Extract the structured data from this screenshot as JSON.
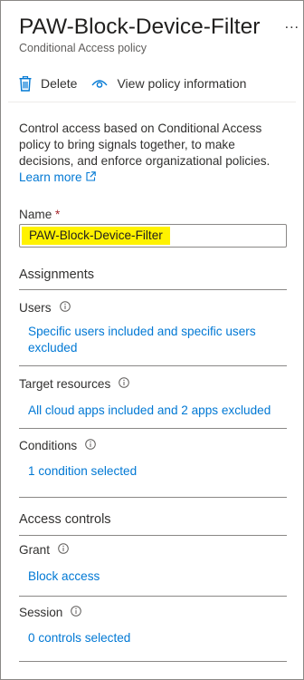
{
  "header": {
    "title": "PAW-Block-Device-Filter",
    "subtitle": "Conditional Access policy",
    "more_label": "..."
  },
  "toolbar": {
    "delete_label": "Delete",
    "view_label": "View policy information"
  },
  "intro": {
    "description": "Control access based on Conditional Access policy to bring signals together, to make decisions, and enforce organizational policies.",
    "learn_more": "Learn more"
  },
  "name_field": {
    "label": "Name",
    "required_marker": "*",
    "value": "PAW-Block-Device-Filter"
  },
  "assignments": {
    "heading": "Assignments",
    "users": {
      "label": "Users",
      "link": "Specific users included and specific users excluded"
    },
    "target_resources": {
      "label": "Target resources",
      "link": "All cloud apps included and 2 apps excluded"
    },
    "conditions": {
      "label": "Conditions",
      "link": "1 condition selected"
    }
  },
  "access_controls": {
    "heading": "Access controls",
    "grant": {
      "label": "Grant",
      "link": "Block access"
    },
    "session": {
      "label": "Session",
      "link": "0 controls selected"
    }
  },
  "colors": {
    "link": "#0078d4",
    "highlight": "#fff200",
    "required": "#a4262c",
    "text": "#323130"
  }
}
